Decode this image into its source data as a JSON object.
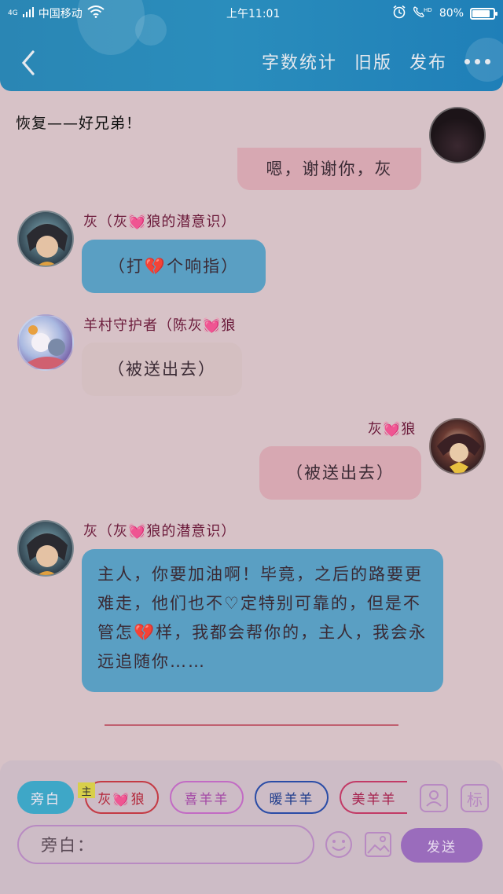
{
  "status_bar": {
    "network_type": "4G",
    "carrier": "中国移动",
    "time": "上午11:01",
    "battery": "80%",
    "battery_level": 0.8
  },
  "header": {
    "actions": [
      "字数统计",
      "旧版",
      "发布"
    ]
  },
  "chat": {
    "title": "恢复——好兄弟！",
    "messages": [
      {
        "side": "right",
        "sender": "",
        "text": "嗯，谢谢你，灰",
        "color": "#d7a8b2"
      },
      {
        "side": "left",
        "sender": "灰（灰💓狼的潜意识）",
        "text": "（打💔个响指）",
        "color": "#5a9fc3"
      },
      {
        "side": "left",
        "sender": "羊村守护者（陈灰💓狼",
        "text": "（被送出去）",
        "color": "#d4bfc1"
      },
      {
        "side": "right",
        "sender": "灰💓狼",
        "text": "（被送出去）",
        "color": "#d7a8b2"
      },
      {
        "side": "left",
        "sender": "灰（灰💓狼的潜意识）",
        "text": "主人，你要加油啊！毕竟，之后的路要更难走，他们也不♡定特别可靠的，但是不管怎💔样，我都会帮你的，主人，我会永远追随你……",
        "color": "#5a9fc3"
      }
    ]
  },
  "composer": {
    "narration_chip": "旁白",
    "master_tag": "主",
    "characters": [
      "灰💓狼",
      "喜羊羊",
      "暖羊羊",
      "美羊羊"
    ],
    "mark_label": "标",
    "input_placeholder": "旁白：",
    "send_label": "发送"
  },
  "colors": {
    "header": "#2a86b4",
    "background": "#d7c2c7",
    "send": "#9a6cbc"
  }
}
